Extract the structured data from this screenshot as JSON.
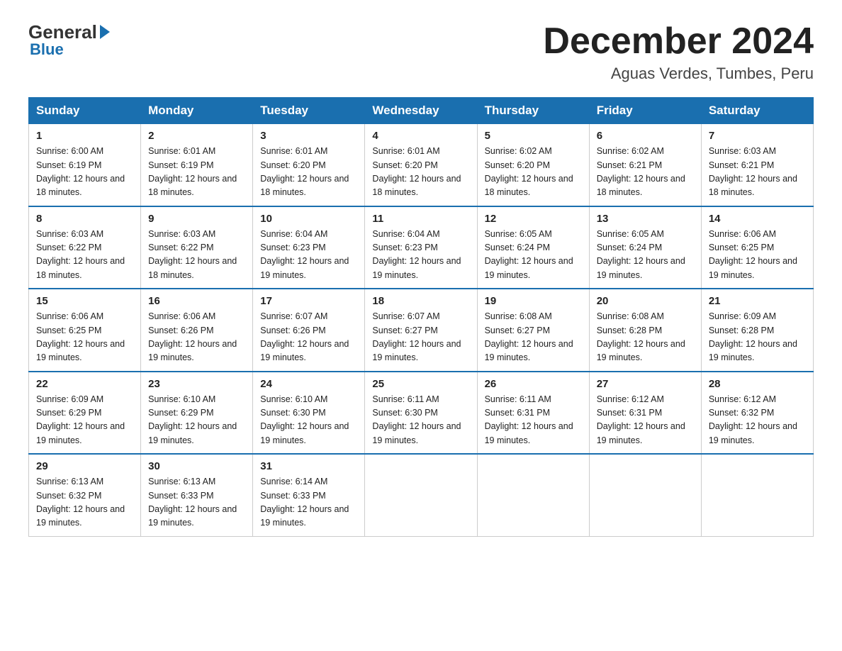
{
  "logo": {
    "general": "General",
    "blue": "Blue"
  },
  "header": {
    "month": "December 2024",
    "location": "Aguas Verdes, Tumbes, Peru"
  },
  "weekdays": [
    "Sunday",
    "Monday",
    "Tuesday",
    "Wednesday",
    "Thursday",
    "Friday",
    "Saturday"
  ],
  "weeks": [
    [
      {
        "day": "1",
        "sunrise": "6:00 AM",
        "sunset": "6:19 PM",
        "daylight": "12 hours and 18 minutes."
      },
      {
        "day": "2",
        "sunrise": "6:01 AM",
        "sunset": "6:19 PM",
        "daylight": "12 hours and 18 minutes."
      },
      {
        "day": "3",
        "sunrise": "6:01 AM",
        "sunset": "6:20 PM",
        "daylight": "12 hours and 18 minutes."
      },
      {
        "day": "4",
        "sunrise": "6:01 AM",
        "sunset": "6:20 PM",
        "daylight": "12 hours and 18 minutes."
      },
      {
        "day": "5",
        "sunrise": "6:02 AM",
        "sunset": "6:20 PM",
        "daylight": "12 hours and 18 minutes."
      },
      {
        "day": "6",
        "sunrise": "6:02 AM",
        "sunset": "6:21 PM",
        "daylight": "12 hours and 18 minutes."
      },
      {
        "day": "7",
        "sunrise": "6:03 AM",
        "sunset": "6:21 PM",
        "daylight": "12 hours and 18 minutes."
      }
    ],
    [
      {
        "day": "8",
        "sunrise": "6:03 AM",
        "sunset": "6:22 PM",
        "daylight": "12 hours and 18 minutes."
      },
      {
        "day": "9",
        "sunrise": "6:03 AM",
        "sunset": "6:22 PM",
        "daylight": "12 hours and 18 minutes."
      },
      {
        "day": "10",
        "sunrise": "6:04 AM",
        "sunset": "6:23 PM",
        "daylight": "12 hours and 19 minutes."
      },
      {
        "day": "11",
        "sunrise": "6:04 AM",
        "sunset": "6:23 PM",
        "daylight": "12 hours and 19 minutes."
      },
      {
        "day": "12",
        "sunrise": "6:05 AM",
        "sunset": "6:24 PM",
        "daylight": "12 hours and 19 minutes."
      },
      {
        "day": "13",
        "sunrise": "6:05 AM",
        "sunset": "6:24 PM",
        "daylight": "12 hours and 19 minutes."
      },
      {
        "day": "14",
        "sunrise": "6:06 AM",
        "sunset": "6:25 PM",
        "daylight": "12 hours and 19 minutes."
      }
    ],
    [
      {
        "day": "15",
        "sunrise": "6:06 AM",
        "sunset": "6:25 PM",
        "daylight": "12 hours and 19 minutes."
      },
      {
        "day": "16",
        "sunrise": "6:06 AM",
        "sunset": "6:26 PM",
        "daylight": "12 hours and 19 minutes."
      },
      {
        "day": "17",
        "sunrise": "6:07 AM",
        "sunset": "6:26 PM",
        "daylight": "12 hours and 19 minutes."
      },
      {
        "day": "18",
        "sunrise": "6:07 AM",
        "sunset": "6:27 PM",
        "daylight": "12 hours and 19 minutes."
      },
      {
        "day": "19",
        "sunrise": "6:08 AM",
        "sunset": "6:27 PM",
        "daylight": "12 hours and 19 minutes."
      },
      {
        "day": "20",
        "sunrise": "6:08 AM",
        "sunset": "6:28 PM",
        "daylight": "12 hours and 19 minutes."
      },
      {
        "day": "21",
        "sunrise": "6:09 AM",
        "sunset": "6:28 PM",
        "daylight": "12 hours and 19 minutes."
      }
    ],
    [
      {
        "day": "22",
        "sunrise": "6:09 AM",
        "sunset": "6:29 PM",
        "daylight": "12 hours and 19 minutes."
      },
      {
        "day": "23",
        "sunrise": "6:10 AM",
        "sunset": "6:29 PM",
        "daylight": "12 hours and 19 minutes."
      },
      {
        "day": "24",
        "sunrise": "6:10 AM",
        "sunset": "6:30 PM",
        "daylight": "12 hours and 19 minutes."
      },
      {
        "day": "25",
        "sunrise": "6:11 AM",
        "sunset": "6:30 PM",
        "daylight": "12 hours and 19 minutes."
      },
      {
        "day": "26",
        "sunrise": "6:11 AM",
        "sunset": "6:31 PM",
        "daylight": "12 hours and 19 minutes."
      },
      {
        "day": "27",
        "sunrise": "6:12 AM",
        "sunset": "6:31 PM",
        "daylight": "12 hours and 19 minutes."
      },
      {
        "day": "28",
        "sunrise": "6:12 AM",
        "sunset": "6:32 PM",
        "daylight": "12 hours and 19 minutes."
      }
    ],
    [
      {
        "day": "29",
        "sunrise": "6:13 AM",
        "sunset": "6:32 PM",
        "daylight": "12 hours and 19 minutes."
      },
      {
        "day": "30",
        "sunrise": "6:13 AM",
        "sunset": "6:33 PM",
        "daylight": "12 hours and 19 minutes."
      },
      {
        "day": "31",
        "sunrise": "6:14 AM",
        "sunset": "6:33 PM",
        "daylight": "12 hours and 19 minutes."
      },
      null,
      null,
      null,
      null
    ]
  ]
}
